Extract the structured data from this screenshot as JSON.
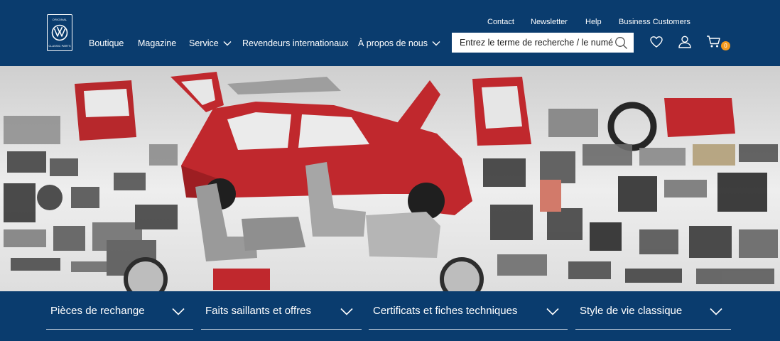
{
  "logo": {
    "top_text": "ORIGINAL",
    "bottom_text": "CLASSIC PARTS"
  },
  "utility_nav": [
    "Contact",
    "Newsletter",
    "Help",
    "Business Customers"
  ],
  "main_nav": [
    {
      "label": "Boutique",
      "has_dropdown": false
    },
    {
      "label": "Magazine",
      "has_dropdown": false
    },
    {
      "label": "Service",
      "has_dropdown": true
    },
    {
      "label": "Revendeurs internationaux",
      "has_dropdown": false
    },
    {
      "label": "À propos de nous",
      "has_dropdown": true
    }
  ],
  "search": {
    "placeholder": "Entrez le terme de recherche / le numéro de pièce"
  },
  "header_icons": [
    "heart-icon",
    "user-icon",
    "cart-icon"
  ],
  "cart": {
    "count": "0"
  },
  "categories": [
    {
      "label": "Pièces de rechange"
    },
    {
      "label": "Faits saillants et offres"
    },
    {
      "label": "Certificats et fiches techniques"
    },
    {
      "label": "Style de vie classique"
    }
  ],
  "colors": {
    "brand_blue": "#0a3c6e",
    "badge_orange": "#f39a1e",
    "car_red": "#c0282d"
  }
}
